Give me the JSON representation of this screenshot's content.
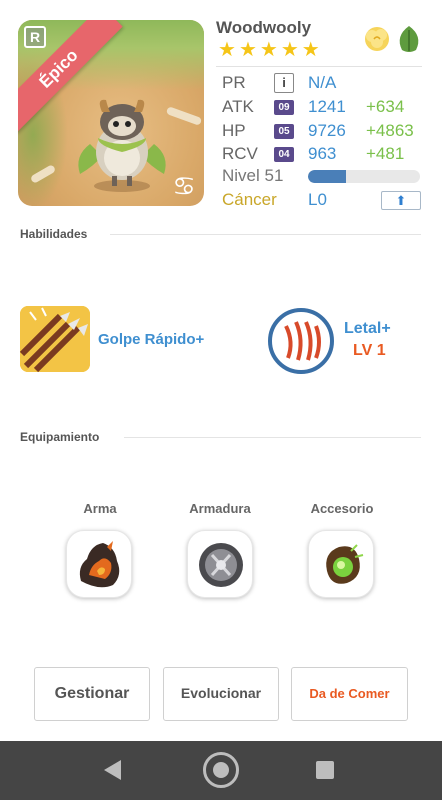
{
  "monster": {
    "name": "Woodwooly",
    "rarity": "Épico",
    "rank_badge": "R",
    "stars": 5,
    "elements": [
      "light-cloud-icon",
      "wood-leaf-icon"
    ]
  },
  "stats": {
    "pr": {
      "label": "PR",
      "value": "N/A"
    },
    "atk": {
      "label": "ATK",
      "level": "09",
      "value": "1241",
      "bonus": "+634"
    },
    "hp": {
      "label": "HP",
      "level": "05",
      "value": "9726",
      "bonus": "+4863"
    },
    "rcv": {
      "label": "RCV",
      "level": "04",
      "value": "963",
      "bonus": "+481"
    },
    "level_label": "Nivel 51",
    "level_progress": 0.34,
    "sign_label": "Cáncer",
    "sign_level": "L0"
  },
  "sections": {
    "skills": "Habilidades",
    "equipment": "Equipamiento"
  },
  "skills": {
    "active_name": "Golpe Rápido+",
    "leader_name": "Letal+",
    "leader_level": "LV 1"
  },
  "equipment": {
    "weapon_label": "Arma",
    "armor_label": "Armadura",
    "accessory_label": "Accesorio"
  },
  "actions": {
    "manage": "Gestionar",
    "evolve": "Evolucionar",
    "feed": "Da de Comer"
  },
  "colors": {
    "accent_blue": "#3f8fd0",
    "bonus_green": "#7ac04a",
    "feed_orange": "#e95a22",
    "rarity_red": "#e7666b"
  }
}
